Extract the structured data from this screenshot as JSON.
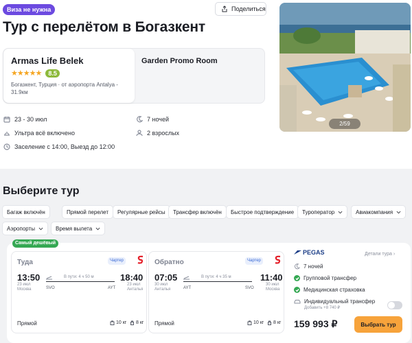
{
  "header": {
    "visa_badge": "Виза не нужна",
    "share_label": "Поделиться",
    "title": "Тур с перелётом в Богазкент"
  },
  "hotel": {
    "name": "Armas Life Belek",
    "stars": "★★★★★",
    "rating": "8.5",
    "location_line1": "Богазкент, Турция · от аэропорта Antalya -",
    "location_line2": "31.9км",
    "room": "Garden Promo Room"
  },
  "photo": {
    "counter": "2/59"
  },
  "details": {
    "dates": "23 - 30 июл",
    "nights": "7 ночей",
    "meal": "Ультра всё включено",
    "guests": "2 взрослых",
    "checkin": "Заселение с 14:00, Выезд до 12:00"
  },
  "section_title": "Выберите тур",
  "filters": [
    "Багаж включён",
    "Прямой перелет",
    "Регулярные рейсы",
    "Трансфер включён",
    "Быстрое подтверждение",
    "Туроператор",
    "Авиакомпания",
    "Аэропорты",
    "Время вылета"
  ],
  "offer": {
    "badge": "Самый дешёвый",
    "outbound": {
      "direction": "Туда",
      "charter": "Чартер",
      "dep_time": "13:50",
      "dep_date": "23 июл",
      "dep_city": "Москва",
      "arr_time": "18:40",
      "arr_date": "23 июл",
      "arr_city": "Анталья",
      "duration": "В пути: 4 ч 50 м",
      "dep_airport": "SVO",
      "arr_airport": "AYT",
      "type": "Прямой",
      "bag1": "10 кг",
      "bag2": "8 кг"
    },
    "inbound": {
      "direction": "Обратно",
      "charter": "Чартер",
      "dep_time": "07:05",
      "dep_date": "30 июл",
      "dep_city": "Анталья",
      "arr_time": "11:40",
      "arr_date": "30 июл",
      "arr_city": "Москва",
      "duration": "В пути: 4 ч 35 м",
      "dep_airport": "AYT",
      "arr_airport": "SVO",
      "type": "Прямой",
      "bag1": "10 кг",
      "bag2": "8 кг"
    },
    "operator": "PEGAS",
    "operator_details": "Детали тура",
    "nights": "7 ночей",
    "feature1": "Групповой трансфер",
    "feature2": "Медицинская страховка",
    "individual_transfer": "Индивидуальный трансфер",
    "individual_transfer_price": "Добавить +8 740 ₽",
    "price": "159 993 ₽",
    "choose_label": "Выбрать тур"
  },
  "colors": {
    "accent_orange": "#f7a33b",
    "visa_purple": "#6c4ae0",
    "rating_green": "#8dba3c",
    "check_green": "#35a853"
  }
}
